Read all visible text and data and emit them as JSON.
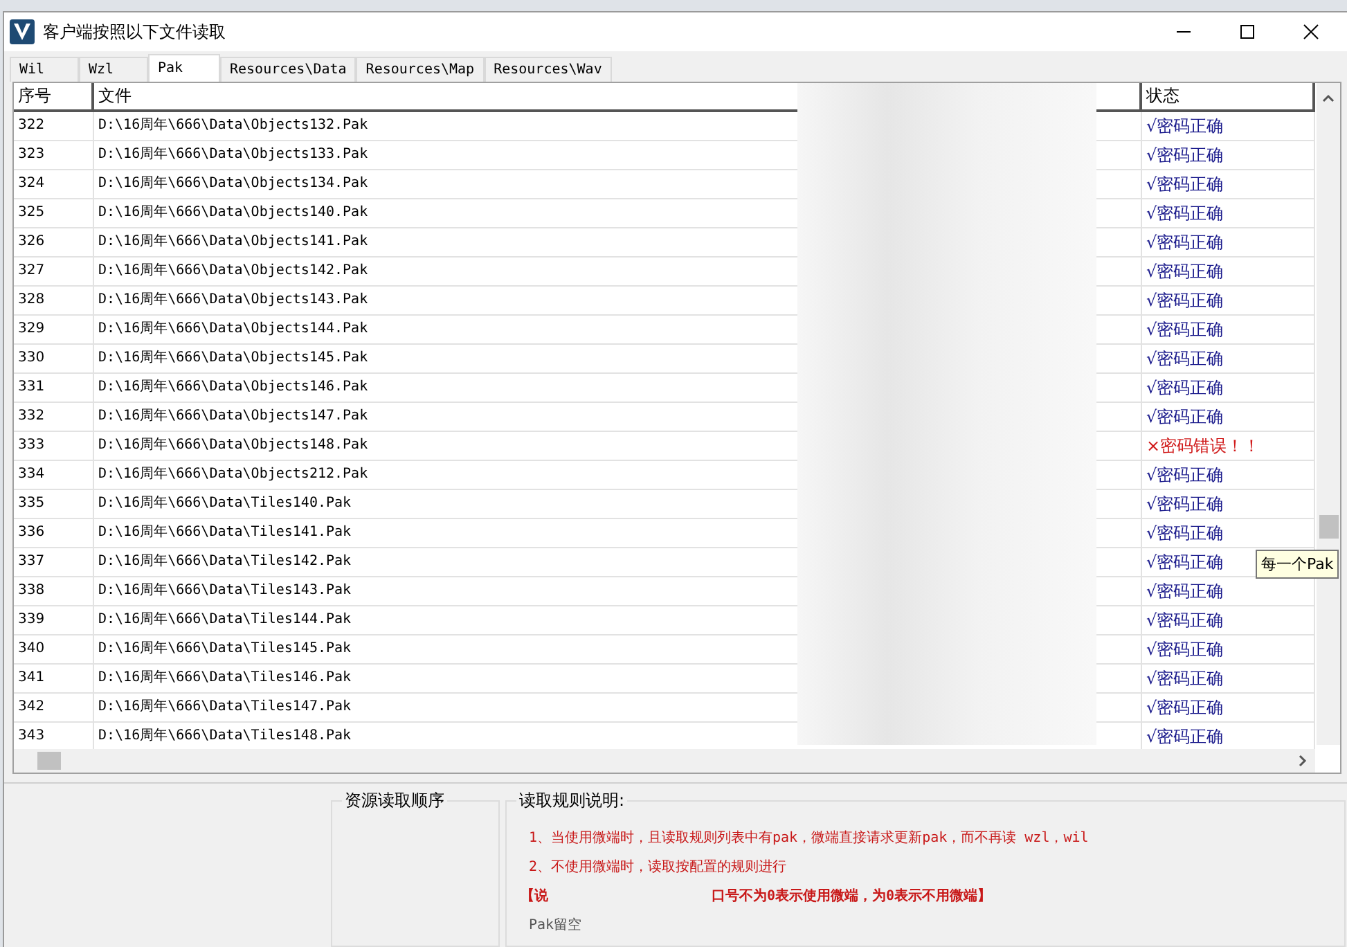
{
  "window": {
    "title": "客户端按照以下文件读取"
  },
  "tabs": [
    {
      "label": "Wil",
      "selected": false
    },
    {
      "label": "Wzl",
      "selected": false
    },
    {
      "label": "Pak",
      "selected": true
    },
    {
      "label": "Resources\\Data",
      "selected": false
    },
    {
      "label": "Resources\\Map",
      "selected": false
    },
    {
      "label": "Resources\\Wav",
      "selected": false
    }
  ],
  "table": {
    "columns": [
      "序号",
      "文件",
      "状态"
    ],
    "rows": [
      {
        "index": "322",
        "file": "D:\\16周年\\666\\Data\\Objects132.Pak",
        "status": "√密码正确",
        "kind": "ok"
      },
      {
        "index": "323",
        "file": "D:\\16周年\\666\\Data\\Objects133.Pak",
        "status": "√密码正确",
        "kind": "ok"
      },
      {
        "index": "324",
        "file": "D:\\16周年\\666\\Data\\Objects134.Pak",
        "status": "√密码正确",
        "kind": "ok"
      },
      {
        "index": "325",
        "file": "D:\\16周年\\666\\Data\\Objects140.Pak",
        "status": "√密码正确",
        "kind": "ok"
      },
      {
        "index": "326",
        "file": "D:\\16周年\\666\\Data\\Objects141.Pak",
        "status": "√密码正确",
        "kind": "ok"
      },
      {
        "index": "327",
        "file": "D:\\16周年\\666\\Data\\Objects142.Pak",
        "status": "√密码正确",
        "kind": "ok"
      },
      {
        "index": "328",
        "file": "D:\\16周年\\666\\Data\\Objects143.Pak",
        "status": "√密码正确",
        "kind": "ok"
      },
      {
        "index": "329",
        "file": "D:\\16周年\\666\\Data\\Objects144.Pak",
        "status": "√密码正确",
        "kind": "ok"
      },
      {
        "index": "330",
        "file": "D:\\16周年\\666\\Data\\Objects145.Pak",
        "status": "√密码正确",
        "kind": "ok"
      },
      {
        "index": "331",
        "file": "D:\\16周年\\666\\Data\\Objects146.Pak",
        "status": "√密码正确",
        "kind": "ok"
      },
      {
        "index": "332",
        "file": "D:\\16周年\\666\\Data\\Objects147.Pak",
        "status": "√密码正确",
        "kind": "ok"
      },
      {
        "index": "333",
        "file": "D:\\16周年\\666\\Data\\Objects148.Pak",
        "status": "×密码错误！！",
        "kind": "error"
      },
      {
        "index": "334",
        "file": "D:\\16周年\\666\\Data\\Objects212.Pak",
        "status": "√密码正确",
        "kind": "ok"
      },
      {
        "index": "335",
        "file": "D:\\16周年\\666\\Data\\Tiles140.Pak",
        "status": "√密码正确",
        "kind": "ok"
      },
      {
        "index": "336",
        "file": "D:\\16周年\\666\\Data\\Tiles141.Pak",
        "status": "√密码正确",
        "kind": "ok"
      },
      {
        "index": "337",
        "file": "D:\\16周年\\666\\Data\\Tiles142.Pak",
        "status": "√密码正确",
        "kind": "ok"
      },
      {
        "index": "338",
        "file": "D:\\16周年\\666\\Data\\Tiles143.Pak",
        "status": "√密码正确",
        "kind": "ok"
      },
      {
        "index": "339",
        "file": "D:\\16周年\\666\\Data\\Tiles144.Pak",
        "status": "√密码正确",
        "kind": "ok"
      },
      {
        "index": "340",
        "file": "D:\\16周年\\666\\Data\\Tiles145.Pak",
        "status": "√密码正确",
        "kind": "ok"
      },
      {
        "index": "341",
        "file": "D:\\16周年\\666\\Data\\Tiles146.Pak",
        "status": "√密码正确",
        "kind": "ok"
      },
      {
        "index": "342",
        "file": "D:\\16周年\\666\\Data\\Tiles147.Pak",
        "status": "√密码正确",
        "kind": "ok"
      },
      {
        "index": "343",
        "file": "D:\\16周年\\666\\Data\\Tiles148.Pak",
        "status": "√密码正确",
        "kind": "ok"
      }
    ]
  },
  "tooltip": "每一个Pak",
  "order_group": {
    "title": "资源读取顺序"
  },
  "rules_group": {
    "title": "读取规则说明:",
    "lines": [
      {
        "text": "1、当使用微端时，且读取规则列表中有pak，微端直接请求更新pak，而不再读 wzl，wil",
        "kind": "red"
      },
      {
        "text": "2、不使用微端时，读取按配置的规则进行",
        "kind": "red"
      },
      {
        "text": "【说",
        "tail": "口号不为0表示使用微端，为0表示不用微端】",
        "kind": "bracket"
      },
      {
        "text": "Pak留空",
        "kind": "plain"
      }
    ]
  }
}
